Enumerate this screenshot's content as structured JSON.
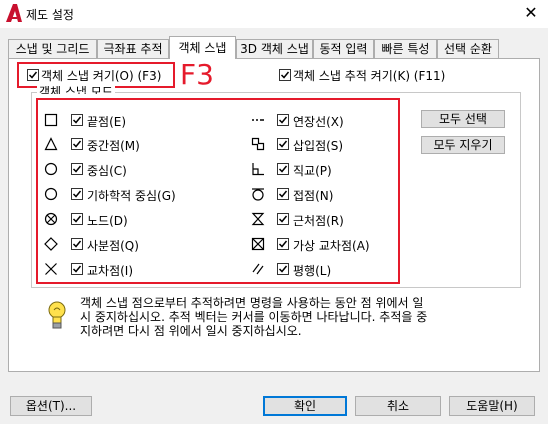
{
  "window": {
    "title": "제도 설정",
    "close_glyph": "✕"
  },
  "tabs": [
    {
      "label": "스냅 및 그리드"
    },
    {
      "label": "극좌표 추적"
    },
    {
      "label": "객체 스냅"
    },
    {
      "label": "3D 객체 스냅"
    },
    {
      "label": "동적 입력"
    },
    {
      "label": "빠른 특성"
    },
    {
      "label": "선택 순환"
    }
  ],
  "active_tab": "객체 스냅",
  "osnap_on": {
    "label": "객체 스냅 켜기(O) (F3)",
    "checked": true
  },
  "annotation": {
    "text": "F3",
    "color": "#e51a2b"
  },
  "tracking_on": {
    "label": "객체 스냅 추적 켜기(K) (F11)",
    "checked": true
  },
  "group_title": "객체 스냅 모드",
  "modes_left": [
    {
      "label": "끝점(E)",
      "icon": "square-icon",
      "checked": true
    },
    {
      "label": "중간점(M)",
      "icon": "triangle-icon",
      "checked": true
    },
    {
      "label": "중심(C)",
      "icon": "circle-icon",
      "checked": true
    },
    {
      "label": "기하학적 중심(G)",
      "icon": "circle-icon",
      "checked": true
    },
    {
      "label": "노드(D)",
      "icon": "node-icon",
      "checked": true
    },
    {
      "label": "사분점(Q)",
      "icon": "diamond-icon",
      "checked": true
    },
    {
      "label": "교차점(I)",
      "icon": "x-icon",
      "checked": true
    }
  ],
  "modes_right": [
    {
      "label": "연장선(X)",
      "icon": "extension-icon",
      "checked": true
    },
    {
      "label": "삽입점(S)",
      "icon": "insertion-icon",
      "checked": true
    },
    {
      "label": "직교(P)",
      "icon": "perpendicular-icon",
      "checked": true
    },
    {
      "label": "접점(N)",
      "icon": "tangent-icon",
      "checked": true
    },
    {
      "label": "근처점(R)",
      "icon": "nearest-icon",
      "checked": true
    },
    {
      "label": "가상 교차점(A)",
      "icon": "apparent-intersection-icon",
      "checked": true
    },
    {
      "label": "평행(L)",
      "icon": "parallel-icon",
      "checked": true
    }
  ],
  "buttons": {
    "select_all": "모두 선택",
    "clear_all": "모두 지우기",
    "options": "옵션(T)...",
    "ok": "확인",
    "cancel": "취소",
    "help": "도움말(H)"
  },
  "info_text": [
    "객체 스냅 점으로부터 추적하려면 명령을 사용하는 동안 점 위에서 일",
    "시 중지하십시오. 추적 벡터는 커서를 이동하면 나타납니다. 추적을 중",
    "지하려면 다시 점 위에서 일시 중지하십시오."
  ],
  "colors": {
    "highlight": "#e51a2b",
    "app_logo": "#c8102e"
  }
}
